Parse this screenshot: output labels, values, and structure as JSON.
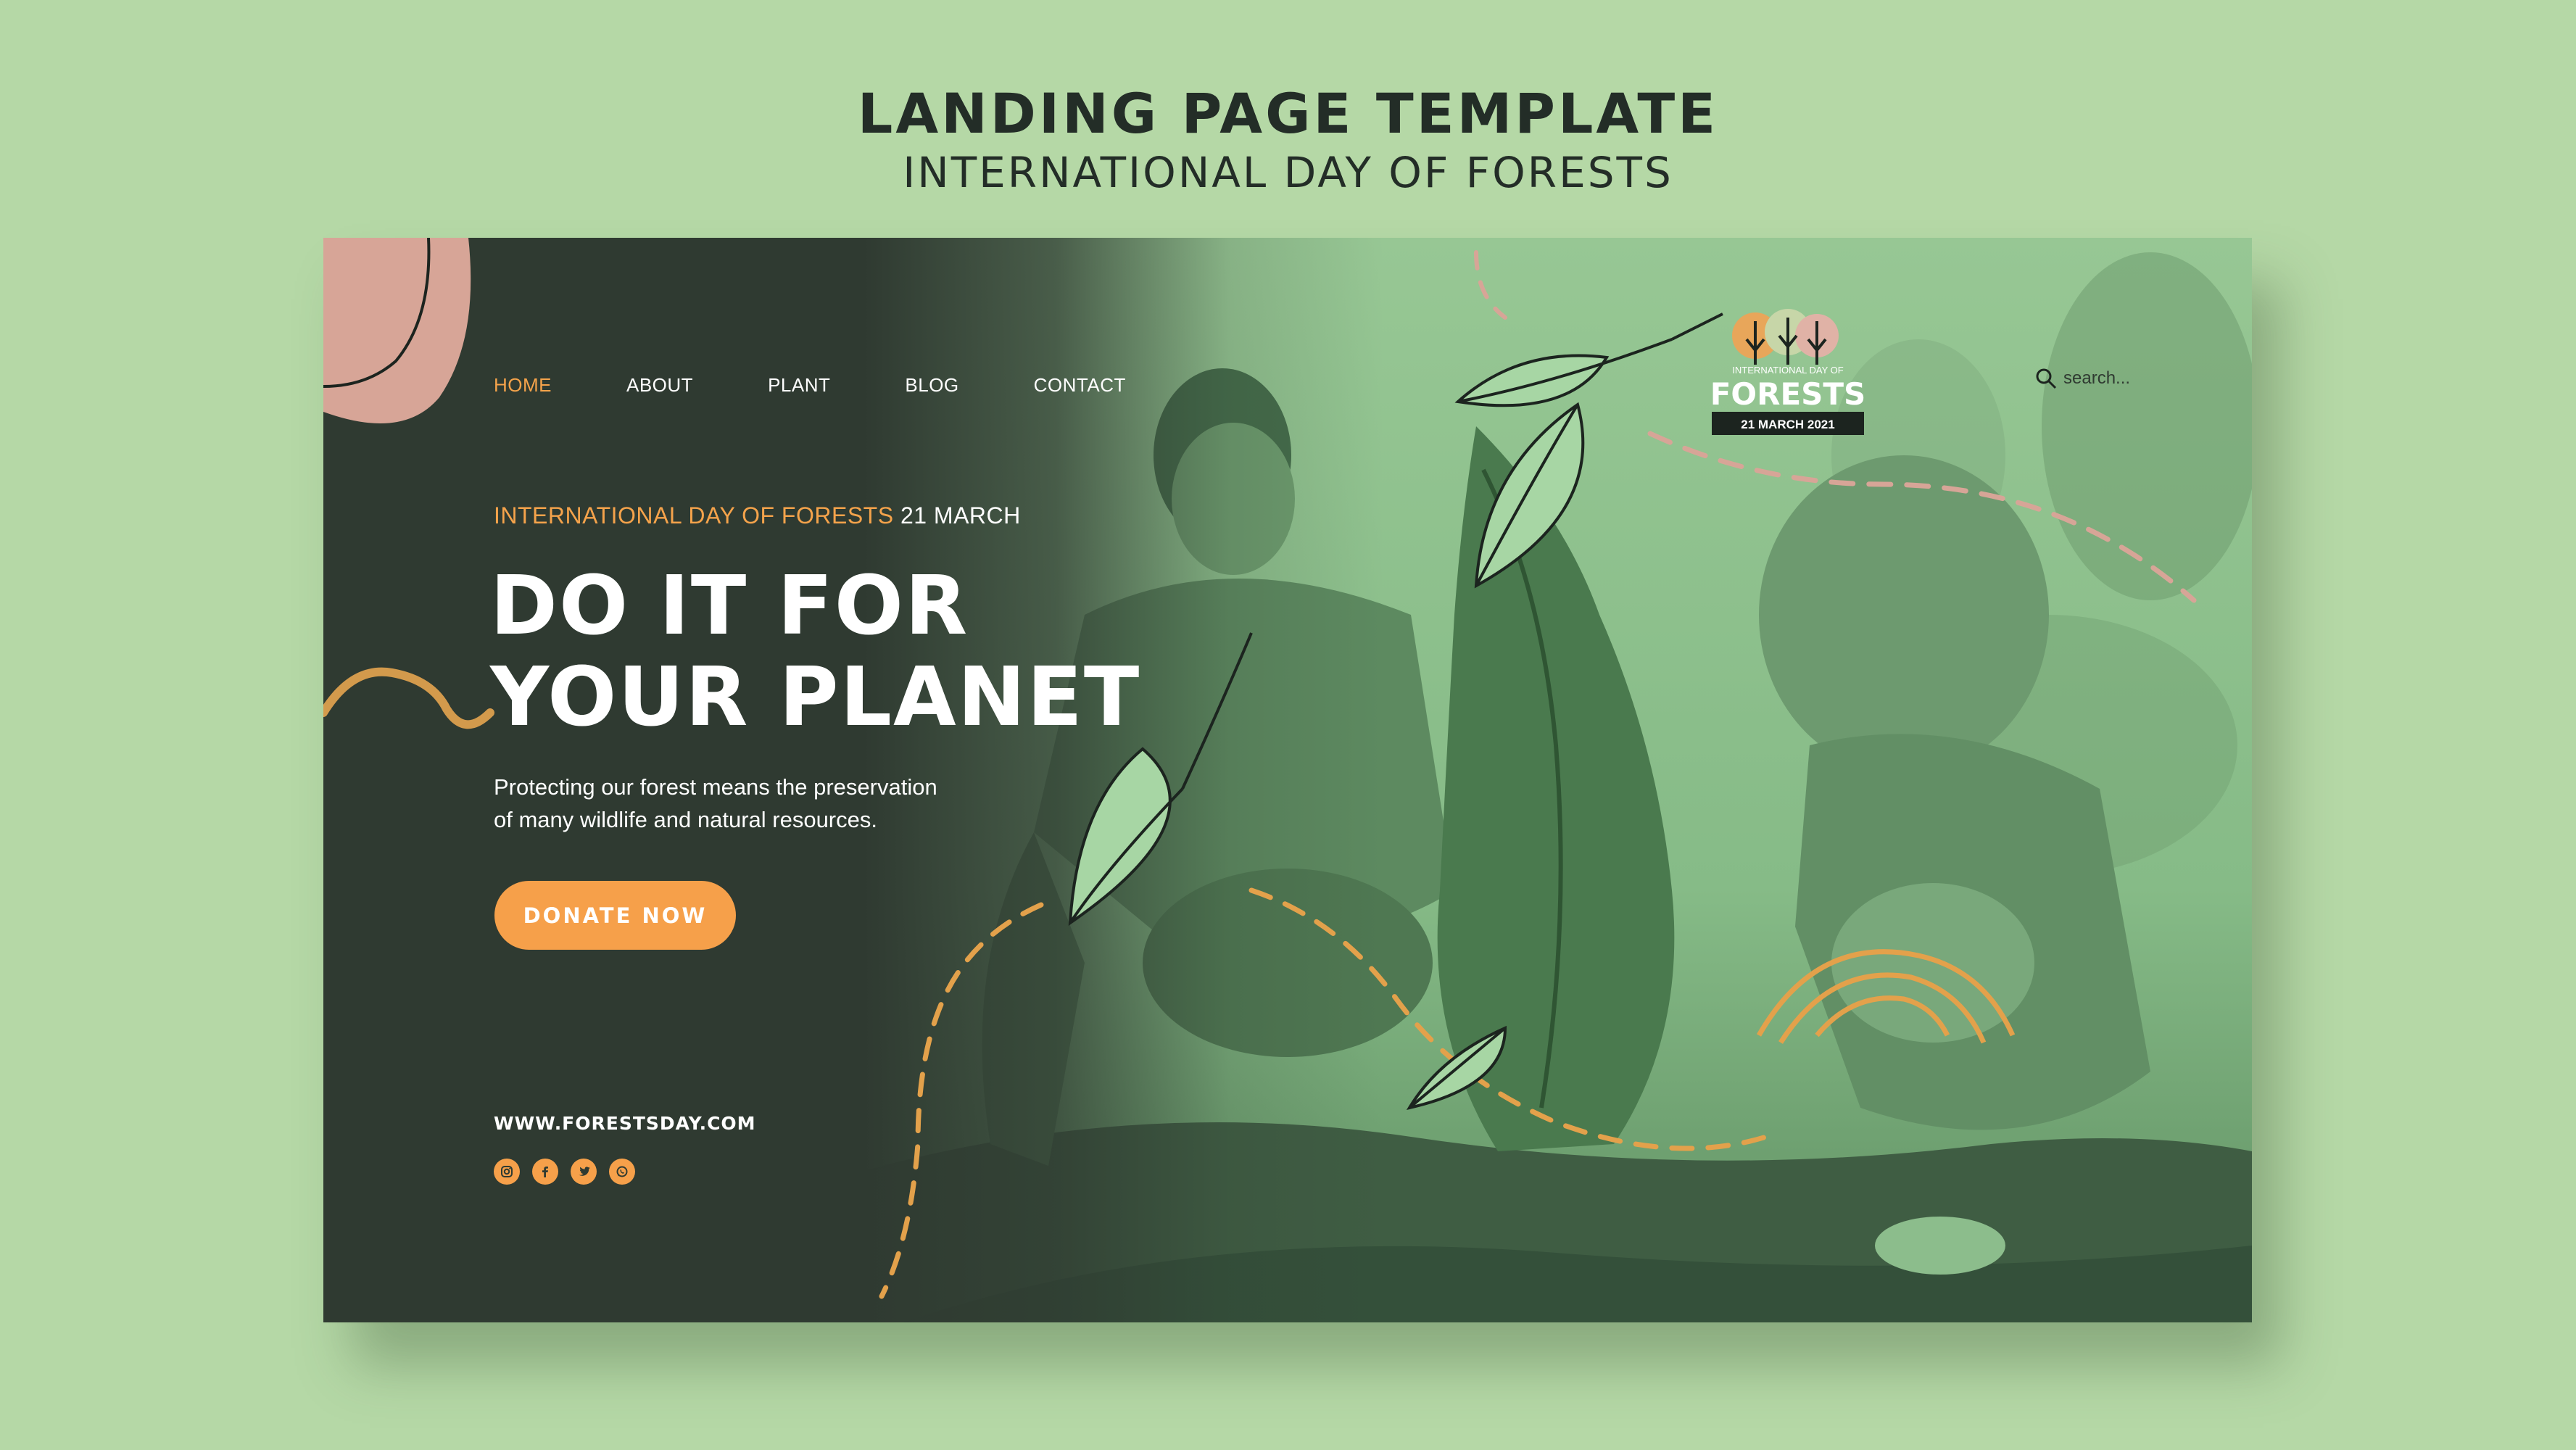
{
  "header": {
    "title": "LANDING PAGE TEMPLATE",
    "subtitle": "INTERNATIONAL DAY OF FORESTS"
  },
  "nav": {
    "items": [
      {
        "label": "HOME",
        "active": true
      },
      {
        "label": "ABOUT",
        "active": false
      },
      {
        "label": "PLANT",
        "active": false
      },
      {
        "label": "BLOG",
        "active": false
      },
      {
        "label": "CONTACT",
        "active": false
      }
    ]
  },
  "logo": {
    "top_text": "INTERNATIONAL DAY OF",
    "name": "FORESTS",
    "date": "21 MARCH 2021"
  },
  "search": {
    "placeholder": "search..."
  },
  "hero": {
    "eyebrow_main": "INTERNATIONAL DAY OF FORESTS",
    "eyebrow_date": "21 MARCH",
    "headline_line1": "DO IT FOR",
    "headline_line2": "YOUR PLANET",
    "description_line1": "Protecting our forest means the preservation",
    "description_line2": "of many wildlife and natural resources.",
    "cta_label": "DONATE NOW"
  },
  "footer": {
    "website": "WWW.FORESTSDAY.COM",
    "socials": [
      "instagram-icon",
      "facebook-icon",
      "twitter-icon",
      "whatsapp-icon"
    ]
  },
  "colors": {
    "page_background": "#b5d8a6",
    "dark_green": "#2f3a31",
    "accent_orange": "#f6a04a",
    "pink": "#d7a597",
    "photo_tint": "#7fb686"
  }
}
